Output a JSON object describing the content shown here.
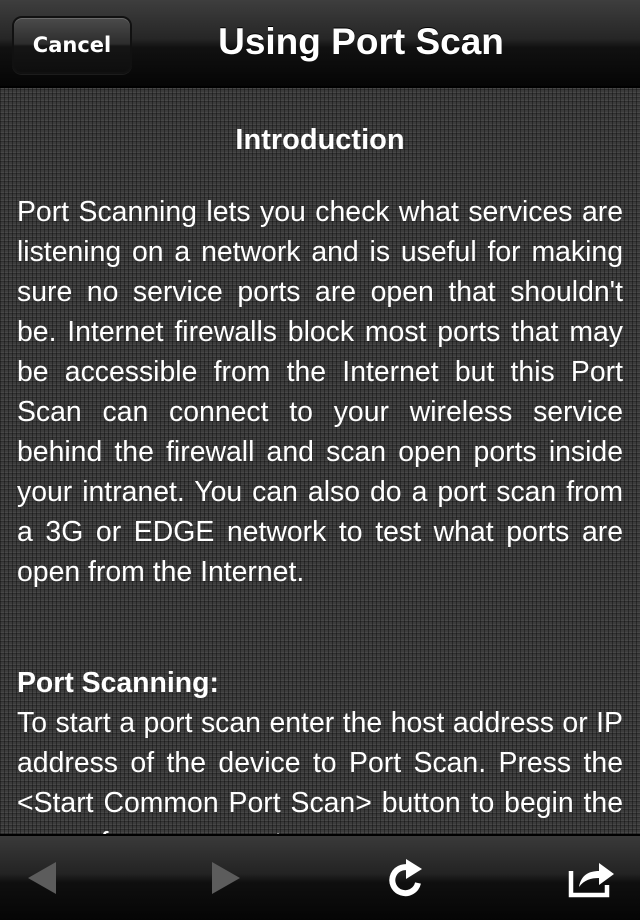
{
  "navbar": {
    "cancel_label": "Cancel",
    "title": "Using Port Scan"
  },
  "content": {
    "intro_heading": "Introduction",
    "intro_text": "Port Scanning lets you check what services are listening on a network and is useful for making sure no service ports are open that shouldn't be. Internet firewalls block most ports that may be accessible from the Internet but this Port Scan can connect to your wireless service behind the firewall and scan open ports inside your intranet. You can also do a port scan from a 3G or EDGE network to test what ports are open from the Internet.",
    "section_heading": "Port Scanning:",
    "section_text": "To start a port scan enter the host address or IP address of the device to Port Scan. Press the <Start Common Port Scan> button to begin the scan of common ports."
  },
  "toolbar": {
    "back_icon": "back-arrow-icon",
    "back_enabled": false,
    "forward_icon": "forward-arrow-icon",
    "forward_enabled": false,
    "reload_icon": "reload-icon",
    "share_icon": "share-icon"
  },
  "colors": {
    "text": "#ffffff",
    "disabled_icon": "#5a5a5a",
    "background": "#3c3c3c"
  }
}
